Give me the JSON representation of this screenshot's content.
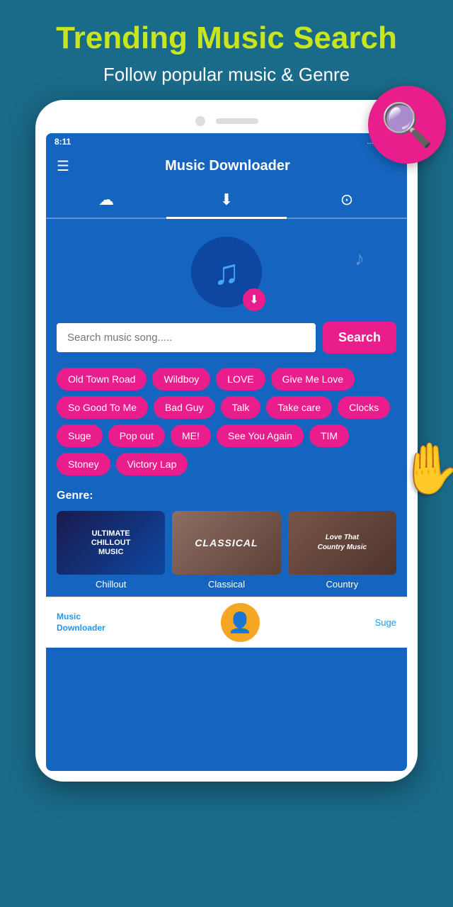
{
  "header": {
    "title": "Trending Music Search",
    "subtitle": "Follow popular music & Genre"
  },
  "app": {
    "title": "Music Downloader",
    "status_time": "8:11",
    "status_icons": "... 📶 🔋"
  },
  "tabs": [
    {
      "label": "☁",
      "active": false
    },
    {
      "label": "⬇",
      "active": true
    },
    {
      "label": "⊙",
      "active": false
    }
  ],
  "search": {
    "placeholder": "Search music song.....",
    "button_label": "Search"
  },
  "tags": [
    "Old Town Road",
    "Wildboy",
    "LOVE",
    "Give Me Love",
    "So Good To Me",
    "Bad Guy",
    "Talk",
    "Take care",
    "Clocks",
    "Suge",
    "Pop out",
    "ME!",
    "See You Again",
    "TIM",
    "Stoney",
    "Victory Lap"
  ],
  "genre": {
    "label": "Genre:",
    "items": [
      {
        "name": "Chillout",
        "display": "ULTIMATE\nCHILLOUT\nMUSIC"
      },
      {
        "name": "Classical",
        "display": "CLASSICAL"
      },
      {
        "name": "Country",
        "display": "Love That\nCountry Music"
      }
    ]
  },
  "bottom_nav": {
    "left_line1": "Music",
    "left_line2": "Downloader",
    "right": "Suge"
  }
}
